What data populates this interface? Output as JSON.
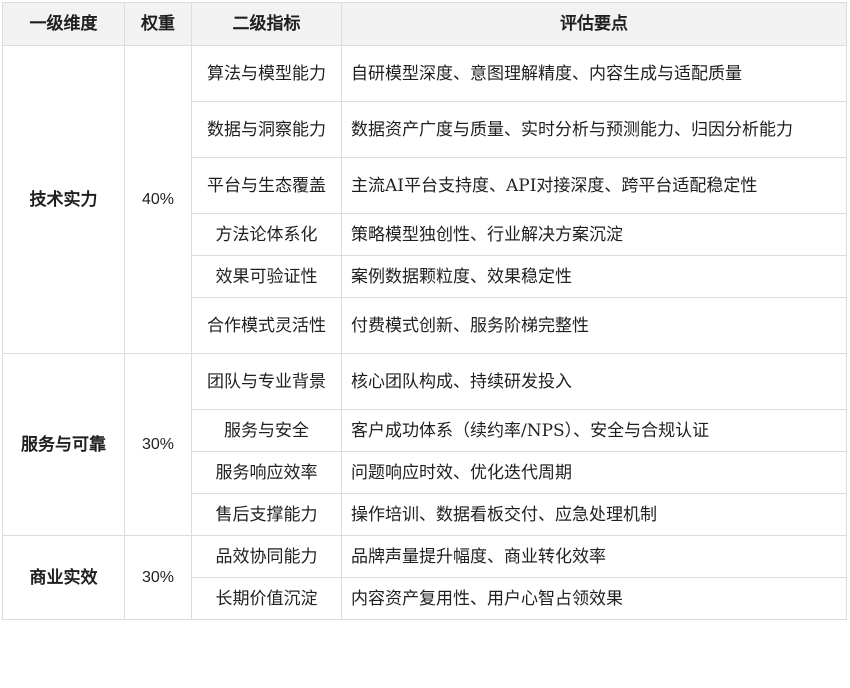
{
  "header": {
    "col1": "一级维度",
    "col2": "权重",
    "col3": "二级指标",
    "col4": "评估要点"
  },
  "groups": [
    {
      "dimension": "技术实力",
      "weight": "40%",
      "rows": [
        {
          "indicator": "算法与模型能力",
          "points": "自研模型深度、意图理解精度、内容生成与适配质量"
        },
        {
          "indicator": "数据与洞察能力",
          "points": "数据资产广度与质量、实时分析与预测能力、归因分析能力"
        },
        {
          "indicator": "平台与生态覆盖",
          "points": "主流AI平台支持度、API对接深度、跨平台适配稳定性"
        },
        {
          "indicator": "方法论体系化",
          "points": "策略模型独创性、行业解决方案沉淀"
        },
        {
          "indicator": "效果可验证性",
          "points": "案例数据颗粒度、效果稳定性"
        },
        {
          "indicator": "合作模式灵活性",
          "points": "付费模式创新、服务阶梯完整性"
        }
      ]
    },
    {
      "dimension": "服务与可靠",
      "weight": "30%",
      "rows": [
        {
          "indicator": "团队与专业背景",
          "points": "核心团队构成、持续研发投入"
        },
        {
          "indicator": "服务与安全",
          "points": "客户成功体系（续约率/NPS）、安全与合规认证"
        },
        {
          "indicator": "服务响应效率",
          "points": "问题响应时效、优化迭代周期"
        },
        {
          "indicator": "售后支撑能力",
          "points": "操作培训、数据看板交付、应急处理机制"
        }
      ]
    },
    {
      "dimension": "商业实效",
      "weight": "30%",
      "rows": [
        {
          "indicator": "品效协同能力",
          "points": "品牌声量提升幅度、商业转化效率"
        },
        {
          "indicator": "长期价值沉淀",
          "points": "内容资产复用性、用户心智占领效果"
        }
      ]
    }
  ]
}
